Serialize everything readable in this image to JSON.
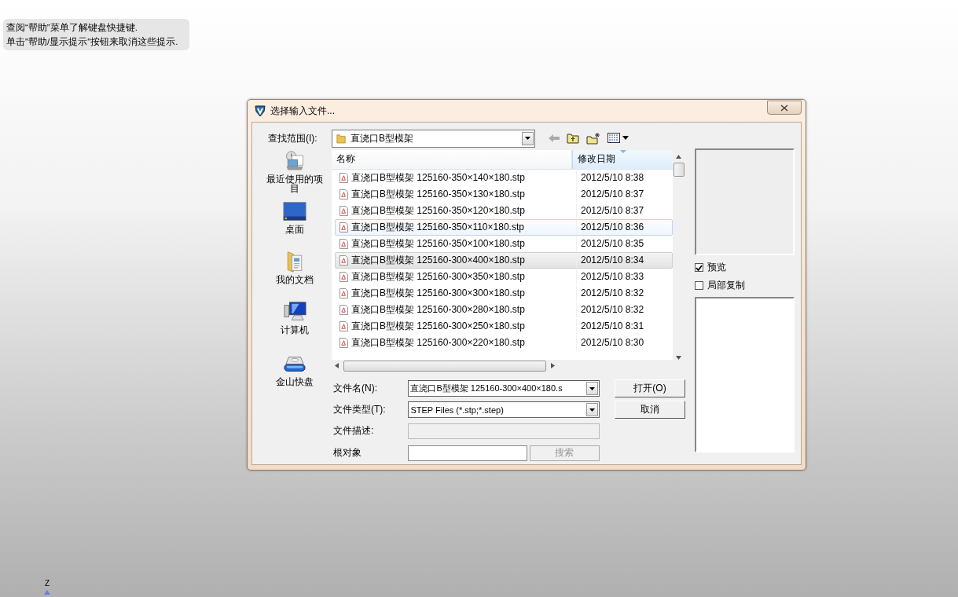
{
  "help_tip": {
    "lines": [
      "查阅“帮助”菜单了解键盘快捷键.",
      "单击\"帮助/显示提示\"按钮来取消这些提示."
    ]
  },
  "dialog": {
    "title": "选择输入文件..."
  },
  "look_in": {
    "label": "查找范围(I):",
    "value": "直浇口B型模架"
  },
  "places": [
    {
      "label": "最近使用的项目",
      "kind": "recent"
    },
    {
      "label": "桌面",
      "kind": "desktop"
    },
    {
      "label": "我的文档",
      "kind": "documents"
    },
    {
      "label": "计算机",
      "kind": "computer"
    },
    {
      "label": "金山快盘",
      "kind": "drive"
    }
  ],
  "file_list": {
    "columns": [
      {
        "label": "名称",
        "sorted": false
      },
      {
        "label": "修改日期",
        "sorted": true
      }
    ],
    "rows": [
      {
        "name": "直浇口B型模架  125160-350×140×180.stp",
        "date": "2012/5/10 8:38",
        "selected": false,
        "hovered": false
      },
      {
        "name": "直浇口B型模架  125160-350×130×180.stp",
        "date": "2012/5/10 8:37",
        "selected": false,
        "hovered": false
      },
      {
        "name": "直浇口B型模架  125160-350×120×180.stp",
        "date": "2012/5/10 8:37",
        "selected": false,
        "hovered": false
      },
      {
        "name": "直浇口B型模架  125160-350×110×180.stp",
        "date": "2012/5/10 8:36",
        "selected": false,
        "hovered": true
      },
      {
        "name": "直浇口B型模架  125160-350×100×180.stp",
        "date": "2012/5/10 8:35",
        "selected": false,
        "hovered": false
      },
      {
        "name": "直浇口B型模架  125160-300×400×180.stp",
        "date": "2012/5/10 8:34",
        "selected": true,
        "hovered": false
      },
      {
        "name": "直浇口B型模架  125160-300×350×180.stp",
        "date": "2012/5/10 8:33",
        "selected": false,
        "hovered": false
      },
      {
        "name": "直浇口B型模架  125160-300×300×180.stp",
        "date": "2012/5/10 8:32",
        "selected": false,
        "hovered": false
      },
      {
        "name": "直浇口B型模架  125160-300×280×180.stp",
        "date": "2012/5/10 8:32",
        "selected": false,
        "hovered": false
      },
      {
        "name": "直浇口B型模架  125160-300×250×180.stp",
        "date": "2012/5/10 8:31",
        "selected": false,
        "hovered": false
      },
      {
        "name": "直浇口B型模架  125160-300×220×180.stp",
        "date": "2012/5/10 8:30",
        "selected": false,
        "hovered": false
      }
    ]
  },
  "form": {
    "fields": [
      {
        "label": "文件名(N):",
        "kind": "combo",
        "value": "直浇口B型模架  125160-300×400×180.s"
      },
      {
        "label": "文件类型(T):",
        "kind": "combo",
        "value": "STEP Files (*.stp;*.step)"
      },
      {
        "label": "文件描述:",
        "kind": "text",
        "disabled": true
      },
      {
        "label": "根对象",
        "kind": "search",
        "disabled": false
      }
    ],
    "search_button": {
      "label": "搜索",
      "disabled": true
    },
    "buttons": [
      "打开(O)",
      "取消"
    ]
  },
  "options": [
    {
      "label": "预览",
      "checked": true
    },
    {
      "label": "局部复制",
      "checked": false
    }
  ],
  "axis": {
    "label": "Z"
  }
}
